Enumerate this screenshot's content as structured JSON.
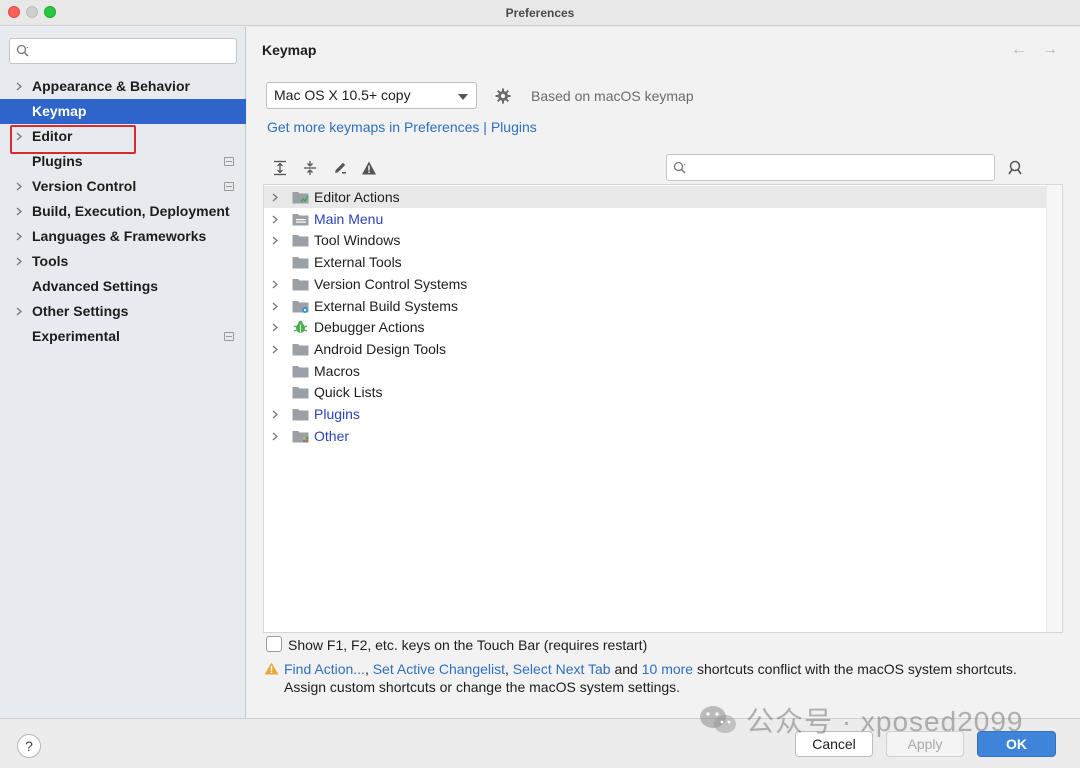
{
  "window": {
    "title": "Preferences"
  },
  "sidebar": {
    "search_placeholder": "",
    "items": [
      {
        "label": "Appearance & Behavior",
        "expandable": true,
        "page_icon": false
      },
      {
        "label": "Keymap",
        "expandable": false,
        "page_icon": false,
        "selected": true
      },
      {
        "label": "Editor",
        "expandable": true,
        "page_icon": false
      },
      {
        "label": "Plugins",
        "expandable": false,
        "page_icon": true
      },
      {
        "label": "Version Control",
        "expandable": true,
        "page_icon": true
      },
      {
        "label": "Build, Execution, Deployment",
        "expandable": true,
        "page_icon": false
      },
      {
        "label": "Languages & Frameworks",
        "expandable": true,
        "page_icon": false
      },
      {
        "label": "Tools",
        "expandable": true,
        "page_icon": false
      },
      {
        "label": "Advanced Settings",
        "expandable": false,
        "page_icon": false
      },
      {
        "label": "Other Settings",
        "expandable": true,
        "page_icon": false
      },
      {
        "label": "Experimental",
        "expandable": false,
        "page_icon": true
      }
    ]
  },
  "main": {
    "title": "Keymap",
    "back_arrow": "←",
    "forward_arrow": "→",
    "keymap_select": "Mac OS X 10.5+ copy",
    "based_on": "Based on macOS keymap",
    "more_keymaps_link": "Get more keymaps in Preferences | Plugins",
    "toolbar_icons": [
      "expand-all-icon",
      "collapse-all-icon",
      "edit-shortcut-icon",
      "warning-conflicts-icon"
    ],
    "tree_search_placeholder": "",
    "tree": [
      {
        "label": "Editor Actions",
        "expandable": true,
        "icon": "editor-actions-folder-icon",
        "link": false,
        "highlighted": true
      },
      {
        "label": "Main Menu",
        "expandable": true,
        "icon": "main-menu-folder-icon",
        "link": true
      },
      {
        "label": "Tool Windows",
        "expandable": true,
        "icon": "folder-icon",
        "link": false
      },
      {
        "label": "External Tools",
        "expandable": false,
        "icon": "folder-icon",
        "link": false
      },
      {
        "label": "Version Control Systems",
        "expandable": true,
        "icon": "folder-icon",
        "link": false
      },
      {
        "label": "External Build Systems",
        "expandable": true,
        "icon": "build-systems-folder-icon",
        "link": false
      },
      {
        "label": "Debugger Actions",
        "expandable": true,
        "icon": "bug-icon",
        "link": false
      },
      {
        "label": "Android Design Tools",
        "expandable": true,
        "icon": "folder-icon",
        "link": false
      },
      {
        "label": "Macros",
        "expandable": false,
        "icon": "folder-icon",
        "link": false
      },
      {
        "label": "Quick Lists",
        "expandable": false,
        "icon": "folder-icon",
        "link": false
      },
      {
        "label": "Plugins",
        "expandable": true,
        "icon": "folder-icon",
        "link": true
      },
      {
        "label": "Other",
        "expandable": true,
        "icon": "other-folder-icon",
        "link": true
      }
    ],
    "touchbar_checkbox": {
      "label": "Show F1, F2, etc. keys on the Touch Bar (requires restart)",
      "checked": false
    },
    "conflict": {
      "link1": "Find Action...",
      "sep1": ", ",
      "link2": "Set Active Changelist",
      "sep2": ", ",
      "link3": "Select Next Tab",
      "and": " and ",
      "link4": "10 more",
      "tail": " shortcuts conflict with the macOS system shortcuts.",
      "line2": "Assign custom shortcuts or change the macOS system settings."
    }
  },
  "buttons": {
    "help": "?",
    "cancel": "Cancel",
    "apply": "Apply",
    "ok": "OK"
  },
  "watermark": {
    "text": "公众号 · xposed2099"
  },
  "colors": {
    "selection": "#2f65ca",
    "link": "#2f6fbd",
    "tree_link": "#2b43b8",
    "ok_button": "#3e84d9",
    "highlight_box": "#d92b2b"
  }
}
